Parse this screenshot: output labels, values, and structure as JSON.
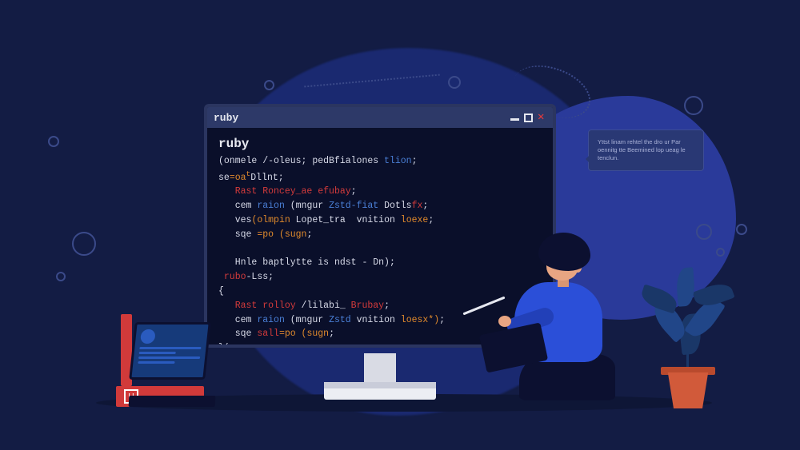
{
  "window": {
    "title": "ruby",
    "min_label": "minimize",
    "max_label": "maximize",
    "close_label": "close"
  },
  "code": {
    "heading": "ruby",
    "l1a": "(onmele /-oleus; ",
    "l1b": "pedBfialones ",
    "l1c": "tlion",
    "l1d": ";",
    "l2a": "se",
    "l2b": "=oa",
    "l2c": "t",
    "l2d": "Dllnt;",
    "l3a": "Rast Roncey_ae efubay",
    "l3b": ";",
    "l4a": "cem",
    "l4b": " raion ",
    "l4c": "(mngur ",
    "l4d": "Zstd-fiat ",
    "l4e": "Dotls",
    "l4f": "fx",
    "l4g": ";",
    "l5a": "ves",
    "l5b": "(olmpin ",
    "l5c": "Lopet_tra ",
    "l5d": " vnition",
    "l5e": " loexe",
    "l5f": ";",
    "l6a": "sqe ",
    "l6b": "=po ",
    "l6c": "(sugn",
    "l6d": ";",
    "l7a": "Hnle baptlytte is ndst - Dn)",
    "l7b": ";",
    "l8a": "rubo",
    "l8b": "-Lss;",
    "l9": "{",
    "l10a": "Rast rolloy ",
    "l10b": "/lilabi_ ",
    "l10c": "Brubay",
    "l10d": ";",
    "l11a": "cem",
    "l11b": " raion ",
    "l11c": "(mngur ",
    "l11d": "Zstd ",
    "l11e": "vnition",
    "l11f": " loesx*)",
    "l11g": ";",
    "l12a": "sqe ",
    "l12b": "sall",
    "l12c": "=po ",
    "l12d": "(sugn",
    "l12e": ";",
    "l13": "}("
  },
  "bubble": {
    "text": "Yttst linam rehtel the dro ur Par oennitg tte Beemined lop ueag le tenclun."
  },
  "book": {
    "label": "U"
  }
}
